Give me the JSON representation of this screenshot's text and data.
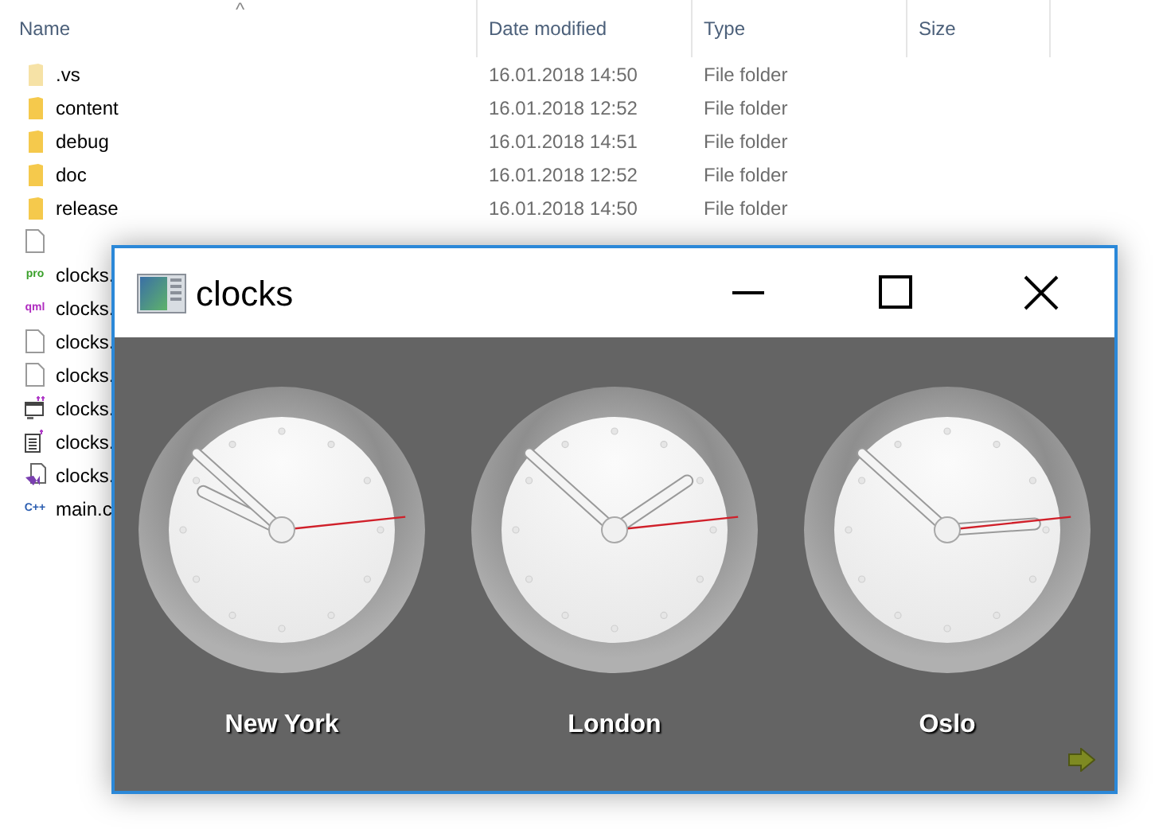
{
  "explorer": {
    "sort_indicator": "^",
    "columns": [
      {
        "label": "Name"
      },
      {
        "label": "Date modified"
      },
      {
        "label": "Type"
      },
      {
        "label": "Size"
      }
    ],
    "rows": [
      {
        "kind": "folder",
        "name": ".vs",
        "date": "16.01.2018 14:50",
        "type": "File folder"
      },
      {
        "kind": "folder",
        "name": "content",
        "date": "16.01.2018 12:52",
        "type": "File folder"
      },
      {
        "kind": "folder",
        "name": "debug",
        "date": "16.01.2018 14:51",
        "type": "File folder"
      },
      {
        "kind": "folder",
        "name": "doc",
        "date": "16.01.2018 12:52",
        "type": "File folder"
      },
      {
        "kind": "folder",
        "name": "release",
        "date": "16.01.2018 14:50",
        "type": "File folder"
      },
      {
        "kind": "file"
      },
      {
        "kind": "tagged",
        "icon_text": "pro",
        "color": "#3aa02a",
        "name": "clocks."
      },
      {
        "kind": "tagged",
        "icon_text": "qml",
        "color": "#b02cc0",
        "name": "clocks."
      },
      {
        "kind": "file",
        "name": "clocks."
      },
      {
        "kind": "file",
        "name": "clocks."
      },
      {
        "kind": "form",
        "name": "clocks."
      },
      {
        "kind": "resource",
        "name": "clocks."
      },
      {
        "kind": "project",
        "name": "clocks."
      },
      {
        "kind": "tagged",
        "icon_text": "C++",
        "color": "#2a5db0",
        "name": "main.c"
      }
    ]
  },
  "window": {
    "title": "clocks",
    "controls": [
      {
        "kind": "minimize"
      },
      {
        "kind": "maximize"
      },
      {
        "kind": "close"
      }
    ],
    "clocks": [
      {
        "city": "New York"
      },
      {
        "city": "London"
      },
      {
        "city": "Oslo"
      }
    ],
    "next_arrow": true
  }
}
